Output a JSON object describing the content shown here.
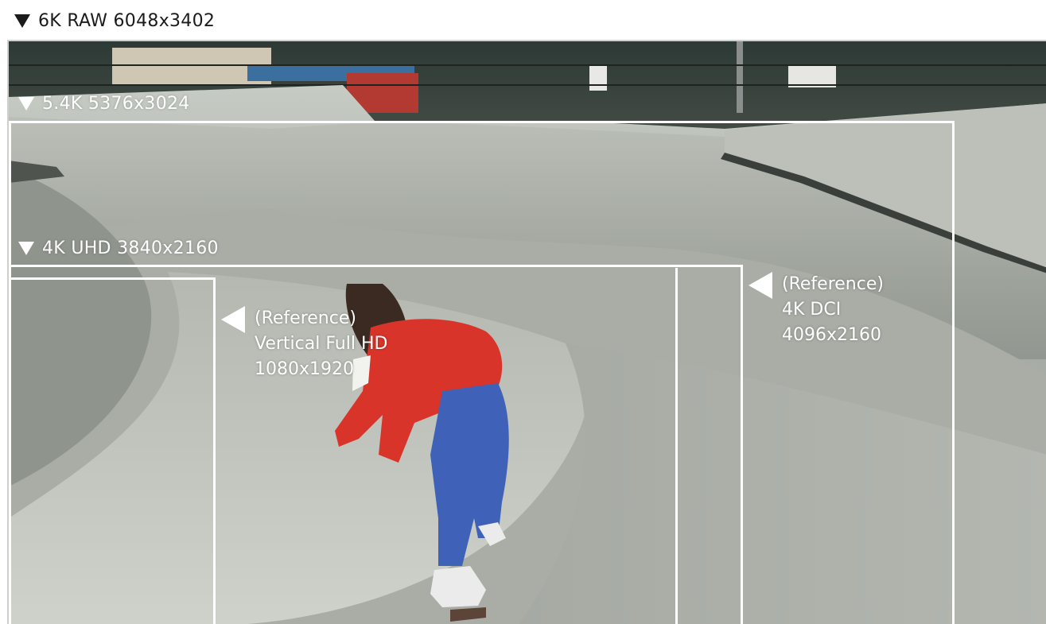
{
  "title_6k": "6K RAW 6048x3402",
  "label_5_4k": "5.4K 5376x3024",
  "label_4k_uhd": "4K UHD 3840x2160",
  "ref_4k_dci": {
    "line1": "(Reference)",
    "line2": "4K DCI",
    "line3": "4096x2160"
  },
  "ref_vertical": {
    "line1": "(Reference)",
    "line2": "Vertical Full HD",
    "line3": "1080x1920"
  },
  "icons": {
    "down": "triangle-down-icon",
    "left": "triangle-left-icon"
  },
  "colors": {
    "frame_line": "#ffffff",
    "label_dark": "#1b1b1b",
    "jacket": "#d8342a",
    "jeans": "#3f62b8"
  }
}
